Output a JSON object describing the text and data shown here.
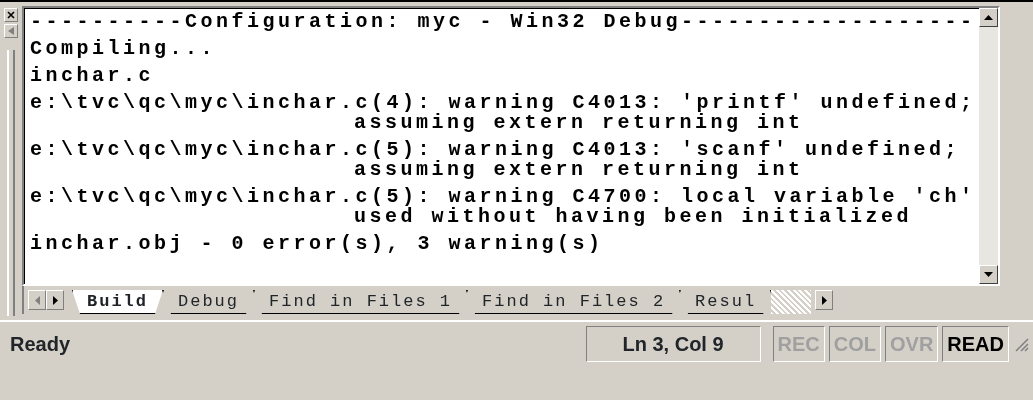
{
  "output": {
    "entries": [
      {
        "lines": [
          "----------Configuration: myc - Win32 Debug-------------------"
        ]
      },
      {
        "lines": [
          "Compiling..."
        ]
      },
      {
        "lines": [
          "inchar.c"
        ]
      },
      {
        "lines": [
          "e:\\tvc\\qc\\myc\\inchar.c(4): warning C4013: 'printf' undefined;",
          "assuming extern returning int"
        ]
      },
      {
        "lines": [
          "e:\\tvc\\qc\\myc\\inchar.c(5): warning C4013: 'scanf' undefined;",
          "assuming extern returning int"
        ]
      },
      {
        "lines": [
          "e:\\tvc\\qc\\myc\\inchar.c(5): warning C4700: local variable 'ch'",
          "used without having been initialized"
        ]
      },
      {
        "lines": [
          "inchar.obj - 0 error(s), 3 warning(s)"
        ]
      }
    ]
  },
  "tabs": [
    {
      "label": "Build",
      "selected": true
    },
    {
      "label": "Debug",
      "selected": false
    },
    {
      "label": "Find in Files 1",
      "selected": false
    },
    {
      "label": "Find in Files 2",
      "selected": false
    },
    {
      "label": "Resul",
      "selected": false
    }
  ],
  "status_bar": {
    "message": "Ready",
    "position": "Ln 3, Col 9",
    "indicators": [
      {
        "label": "REC",
        "on": false
      },
      {
        "label": "COL",
        "on": false
      },
      {
        "label": "OVR",
        "on": false
      },
      {
        "label": "READ",
        "on": true
      }
    ]
  }
}
